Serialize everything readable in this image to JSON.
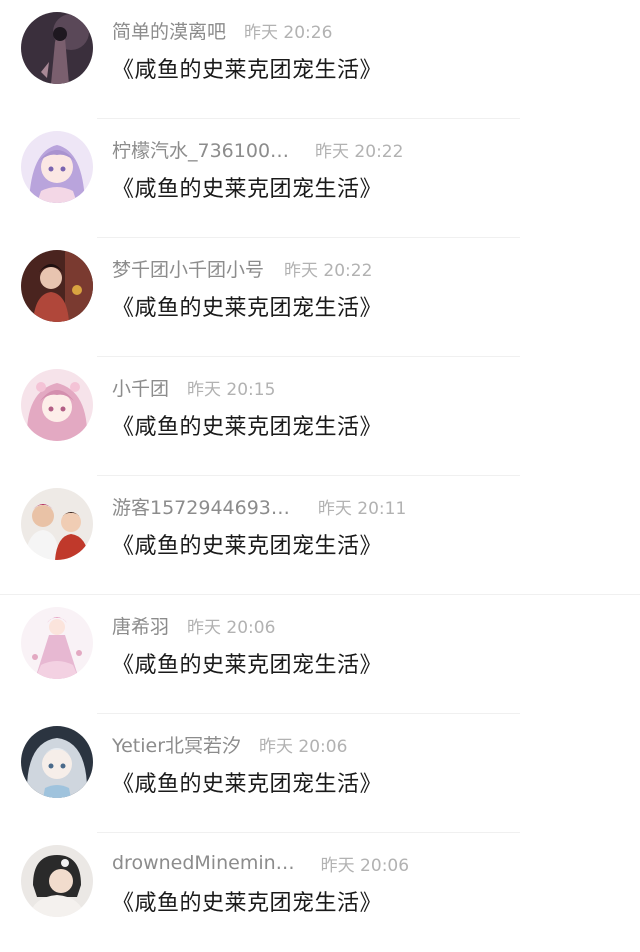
{
  "messages": [
    {
      "name": "简单的漠离吧",
      "time": "昨天 20:26",
      "text": "《咸鱼的史莱克团宠生活》",
      "avatar_icon": "avatar-dark-figure",
      "avatar_colors": [
        "#3a2f3c",
        "#7a5f6e"
      ]
    },
    {
      "name": "柠檬汽水_736100…",
      "time": "昨天 20:22",
      "text": "《咸鱼的史莱克团宠生活》",
      "avatar_icon": "avatar-anime-girl-purple",
      "avatar_colors": [
        "#d8c8ec",
        "#a993cf"
      ]
    },
    {
      "name": "梦千团小千团小号",
      "time": "昨天 20:22",
      "text": "《咸鱼的史莱克团宠生活》",
      "avatar_icon": "avatar-red-costume",
      "avatar_colors": [
        "#5a2a22",
        "#b0473a"
      ]
    },
    {
      "name": "小千团",
      "time": "昨天 20:15",
      "text": "《咸鱼的史莱克团宠生活》",
      "avatar_icon": "avatar-pink-anime",
      "avatar_colors": [
        "#f2d7e2",
        "#e3a9c2"
      ]
    },
    {
      "name": "游客1572944693…",
      "time": "昨天 20:11",
      "text": "《咸鱼的史莱克团宠生活》",
      "avatar_icon": "avatar-two-people",
      "avatar_colors": [
        "#e8e2de",
        "#c0392b"
      ]
    },
    {
      "name": "唐希羽",
      "time": "昨天 20:06",
      "text": "《咸鱼的史莱克团宠生活》",
      "avatar_icon": "avatar-pink-dress",
      "avatar_colors": [
        "#f7eef4",
        "#e7b8d2"
      ]
    },
    {
      "name": "Yetier北冥若汐",
      "time": "昨天 20:06",
      "text": "《咸鱼的史莱克团宠生活》",
      "avatar_icon": "avatar-white-hair",
      "avatar_colors": [
        "#2b3440",
        "#cfd6de"
      ]
    },
    {
      "name": "drownedMinemin…",
      "time": "昨天 20:06",
      "text": "《咸鱼的史莱克团宠生活》",
      "avatar_icon": "avatar-girl-photo",
      "avatar_colors": [
        "#e9e6e3",
        "#2a2a2a"
      ]
    }
  ]
}
